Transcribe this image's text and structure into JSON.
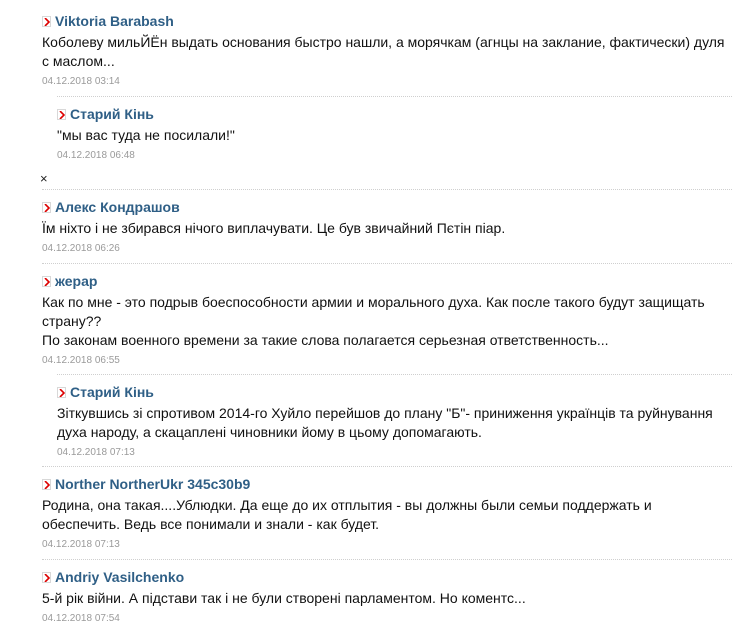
{
  "comments": [
    {
      "author": "Viktoria Barabash",
      "text": "Коболеву мильЙЁн выдать основания быстро нашли, а морячкам (агнцы на заклание, фактически) дуля с маслом...",
      "date": "04.12.2018 03:14"
    },
    {
      "author": "Старий Кінь",
      "text": "\"мы вас туда не посилали!\"",
      "date": "04.12.2018 06:48"
    },
    {
      "author": "Алекс Кондрашов",
      "text": "Їм ніхто і не збирався нічого виплачувати. Це був звичайний Пєтін піар.",
      "date": "04.12.2018 06:26"
    },
    {
      "author": "жерар",
      "text": "Как по мне - это подрыв боеспособности армии и морального духа. Как после такого будут защищать страну??",
      "text2": "По законам военного времени за такие слова полагается серьезная ответственность...",
      "date": "04.12.2018 06:55"
    },
    {
      "author": "Старий Кінь",
      "text": "Зіткувшись зі спротивом 2014-го Хуйло перейшов до плану \"Б\"- приниження українців та руйнування духа народу, а скацаплені чиновники йому в цьому допомагають.",
      "date": "04.12.2018 07:13"
    },
    {
      "author": "Norther NortherUkr 345c30b9",
      "text": "Родина, она такая....Ублюдки. Да еще до их отплытия - вы должны были семьи поддержать и обеспечить. Ведь все понимали и знали - как будет.",
      "date": "04.12.2018 07:13"
    },
    {
      "author": "Andriy Vasilchenko",
      "text": "5-й рік війни. А підстави так і не були створені парламентом. Но коментс...",
      "date": "04.12.2018 07:54"
    }
  ],
  "close_symbol": "×"
}
